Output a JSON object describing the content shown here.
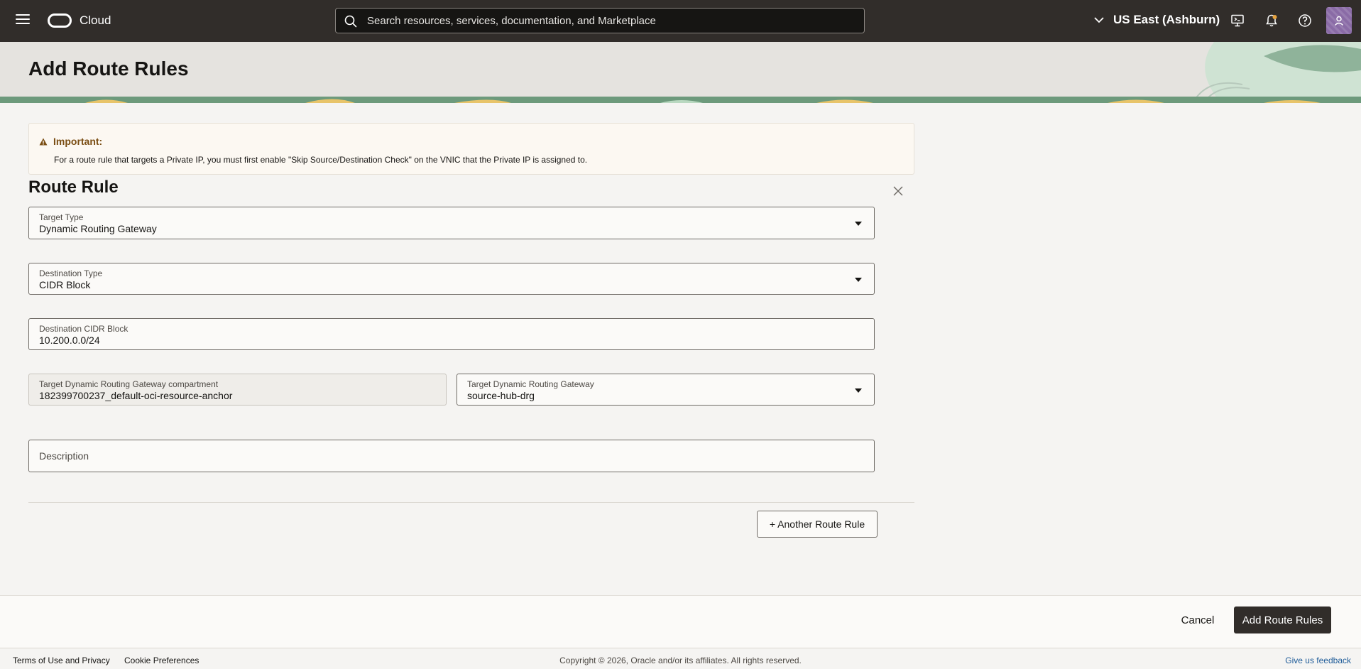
{
  "header": {
    "brand": "Cloud",
    "search_placeholder": "Search resources, services, documentation, and Marketplace",
    "region": "US East (Ashburn)"
  },
  "page": {
    "title": "Add Route Rules"
  },
  "notice": {
    "heading": "Important:",
    "text": "For a route rule that targets a Private IP, you must first enable \"Skip Source/Destination Check\" on the VNIC that the Private IP is assigned to."
  },
  "route_rule": {
    "section_title": "Route Rule",
    "target_type": {
      "label": "Target Type",
      "value": "Dynamic Routing Gateway"
    },
    "destination_type": {
      "label": "Destination Type",
      "value": "CIDR Block"
    },
    "destination_cidr": {
      "label": "Destination CIDR Block",
      "value": "10.200.0.0/24"
    },
    "drg_compartment": {
      "label": "Target Dynamic Routing Gateway compartment",
      "value": "182399700237_default-oci-resource-anchor"
    },
    "drg": {
      "label": "Target Dynamic Routing Gateway",
      "value": "source-hub-drg"
    },
    "description": {
      "placeholder": "Description"
    },
    "another_button": "+ Another Route Rule"
  },
  "actions": {
    "cancel": "Cancel",
    "submit": "Add Route Rules"
  },
  "footer": {
    "terms": "Terms of Use and Privacy",
    "cookies": "Cookie Preferences",
    "copyright": "Copyright © 2026, Oracle and/or its affiliates. All rights reserved.",
    "feedback": "Give us feedback"
  },
  "colors": {
    "header_bg": "#312d2a",
    "banner_bg": "#e5e3df",
    "notice_heading": "#7a4e14",
    "link": "#1f5c99"
  },
  "icons": [
    "hamburger-icon",
    "oracle-logo",
    "search-icon",
    "chevron-down-icon",
    "cloud-shell-icon",
    "bell-icon",
    "help-icon",
    "user-icon",
    "warning-icon",
    "close-icon"
  ]
}
